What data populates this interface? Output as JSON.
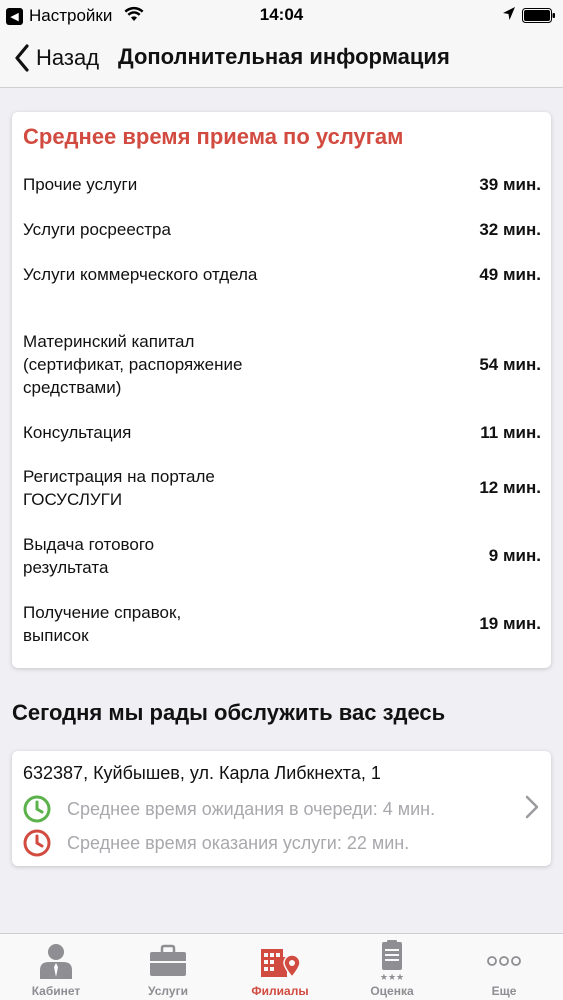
{
  "status_bar": {
    "back_app": "Настройки",
    "time": "14:04"
  },
  "nav": {
    "back_label": "Назад",
    "title": "Дополнительная информация"
  },
  "service_times": {
    "title": "Среднее время приема по услугам",
    "items": [
      {
        "name": "Прочие услуги",
        "time": "39 мин."
      },
      {
        "name": "Услуги росреестра",
        "time": "32 мин."
      },
      {
        "name": "Услуги коммерческого отдела",
        "time": "49 мин."
      },
      {
        "name": "Материнский капитал (сертификат, распоряжение средствами)",
        "time": "54 мин."
      },
      {
        "name": "Консультация",
        "time": "11 мин."
      },
      {
        "name": "Регистрация на портале ГОСУСЛУГИ",
        "time": "12 мин."
      },
      {
        "name": "Выдача готового результата",
        "time": "9 мин."
      },
      {
        "name": "Получение справок, выписок",
        "time": "19 мин."
      }
    ]
  },
  "branch_section": {
    "heading": "Сегодня мы рады обслужить вас здесь",
    "address": "632387, Куйбышев, ул. Карла Либкнехта, 1",
    "wait_time": "Среднее время ожидания в очереди: 4 мин.",
    "service_time": "Среднее время оказания услуги: 22 мин."
  },
  "tabs": [
    {
      "label": "Кабинет",
      "icon": "person-icon",
      "active": false
    },
    {
      "label": "Услуги",
      "icon": "briefcase-icon",
      "active": false
    },
    {
      "label": "Филиалы",
      "icon": "building-icon",
      "active": true
    },
    {
      "label": "Оценка",
      "icon": "clipboard-icon",
      "active": false
    },
    {
      "label": "Еще",
      "icon": "more-icon",
      "active": false
    }
  ],
  "colors": {
    "accent": "#d24b40",
    "wait_icon": "#5cb24a",
    "service_icon": "#d24b40",
    "inactive": "#8e8e93"
  }
}
